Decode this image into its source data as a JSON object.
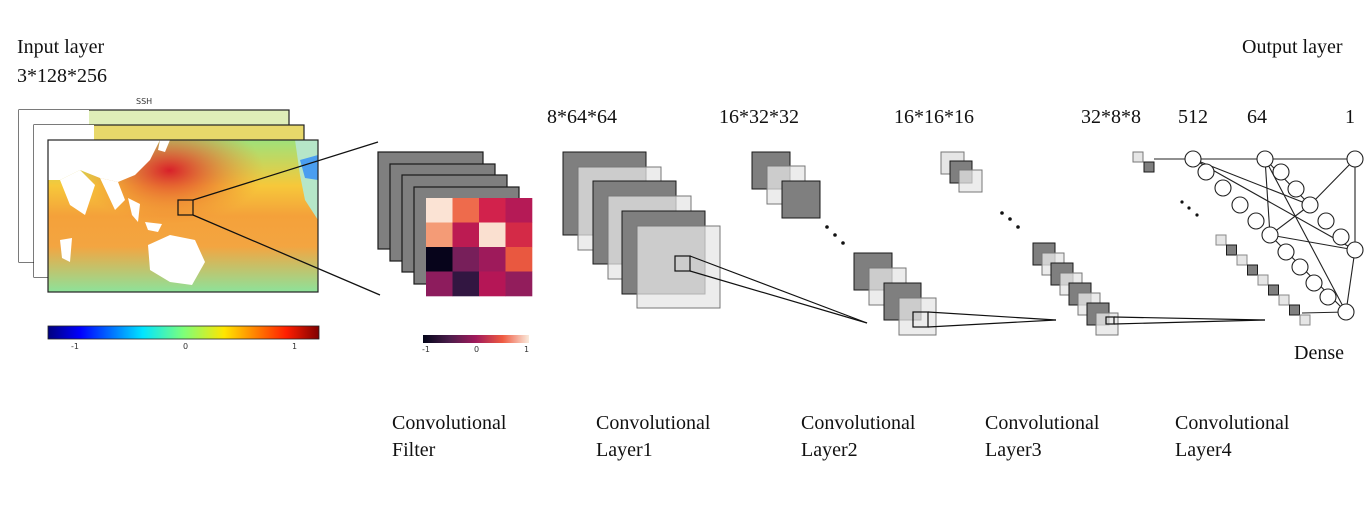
{
  "input": {
    "title": "Input layer",
    "shape": "3*128*256",
    "map_title": "SSH",
    "colorbar": {
      "colormap": "jet",
      "ticks": [
        "-1",
        "0",
        "1"
      ],
      "range": [
        -1.2,
        1.2
      ]
    }
  },
  "filter": {
    "label_line1": "Convolutional",
    "label_line2": "Filter",
    "grid_values": [
      [
        1.0,
        0.45,
        0.05,
        -0.1
      ],
      [
        0.6,
        -0.05,
        0.95,
        0.1
      ],
      [
        -1.0,
        -0.45,
        -0.25,
        0.35
      ],
      [
        -0.3,
        -0.8,
        -0.05,
        -0.25
      ]
    ],
    "grid_colors": [
      [
        "#fbe3d4",
        "#ee6b4c",
        "#d2224c",
        "#b51a56"
      ],
      [
        "#f49b76",
        "#bc1b52",
        "#fae0d0",
        "#d42a47"
      ],
      [
        "#07041b",
        "#771f5a",
        "#9e1a5b",
        "#e95840"
      ],
      [
        "#8d1c5d",
        "#321641",
        "#b51656",
        "#921d5c"
      ]
    ],
    "colorbar": {
      "colormap": "rocket",
      "ticks": [
        "-1",
        "0",
        "1"
      ]
    }
  },
  "layers": [
    {
      "id": "conv1",
      "shape": "8*64*64",
      "label_line1": "Convolutional",
      "label_line2": "Layer1"
    },
    {
      "id": "conv2",
      "shape": "16*32*32",
      "label_line1": "Convolutional",
      "label_line2": "Layer2"
    },
    {
      "id": "conv3",
      "shape": "16*16*16",
      "label_line1": "Convolutional",
      "label_line2": "Layer3"
    },
    {
      "id": "conv4",
      "shape": "32*8*8",
      "label_line1": "Convolutional",
      "label_line2": "Layer4"
    }
  ],
  "dense": {
    "label": "Dense",
    "sizes": [
      "512",
      "64",
      "1"
    ]
  },
  "output": {
    "title": "Output layer"
  },
  "colors": {
    "dark_fmap": "#7f7f7f",
    "light_fmap": "#e6e6e6",
    "mid_fmap": "#c8c8c8",
    "outline": "#1a1a1a"
  }
}
